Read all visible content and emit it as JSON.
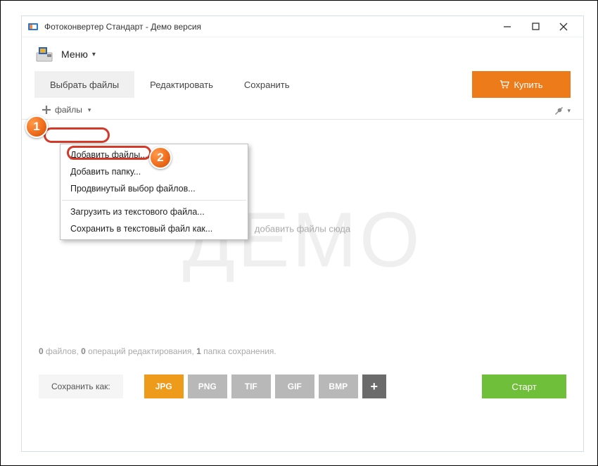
{
  "window": {
    "title": "Фотоконвертер Стандарт - Демо версия"
  },
  "menu": {
    "label": "Меню"
  },
  "tabs": {
    "select_files": "Выбрать файлы",
    "edit": "Редактировать",
    "save": "Сохранить"
  },
  "buy": {
    "label": "Купить"
  },
  "files_dropdown": {
    "label": "файлы"
  },
  "context_menu": {
    "add_files": "Добавить файлы...",
    "add_folder": "Добавить папку...",
    "advanced_select": "Продвинутый выбор файлов...",
    "load_from_txt": "Загрузить из текстового файла...",
    "save_to_txt": "Сохранить в текстовый файл как..."
  },
  "dropzone": {
    "watermark": "ДЕМО",
    "hint": "добавить файлы сюда"
  },
  "status": {
    "files_count": "0",
    "files_word": " файлов, ",
    "ops_count": "0",
    "ops_word": " операций редактирования, ",
    "folders_count": "1",
    "folders_word": " папка сохранения."
  },
  "bottom": {
    "saveas": "Сохранить как:",
    "formats": {
      "jpg": "JPG",
      "png": "PNG",
      "tif": "TIF",
      "gif": "GIF",
      "bmp": "BMP",
      "plus": "+"
    },
    "start": "Старт"
  },
  "annotations": {
    "badge1": "1",
    "badge2": "2"
  }
}
